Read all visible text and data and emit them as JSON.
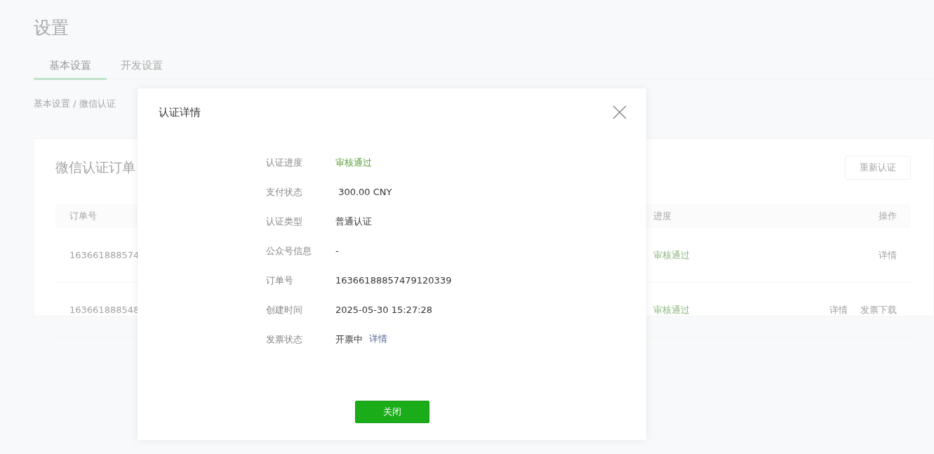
{
  "page": {
    "title": "设置",
    "tabs": [
      {
        "label": "基本设置",
        "selected": true
      },
      {
        "label": "开发设置",
        "selected": false
      }
    ],
    "breadcrumb": "基本设置 / 微信认证",
    "card": {
      "title": "微信认证订单",
      "action": "重新认证",
      "columns": [
        {
          "label": "订单号"
        },
        {
          "label": "进度"
        },
        {
          "label": "操作"
        }
      ],
      "rows": [
        {
          "order": "163661888574",
          "progress": "审核通过",
          "actions": [
            "详情"
          ]
        },
        {
          "order": "163661888548",
          "progress": "审核通过",
          "actions": [
            "详情",
            "发票下载"
          ]
        }
      ]
    }
  },
  "dialog": {
    "title": "认证详情",
    "fields": [
      {
        "label": "认证进度",
        "kind": "status",
        "value": "审核通过"
      },
      {
        "label": "支付状态",
        "kind": "text",
        "value": " 300.00 CNY"
      },
      {
        "label": "认证类型",
        "kind": "text",
        "value": "普通认证"
      },
      {
        "label": "公众号信息",
        "kind": "text",
        "value": "-"
      },
      {
        "label": "订单号",
        "kind": "text",
        "value": "16366188857479120339"
      },
      {
        "label": "创建时间",
        "kind": "text",
        "value": "2025-05-30 15:27:28"
      },
      {
        "label": "发票状态",
        "kind": "invoice",
        "value": "开票中",
        "link": "详情"
      }
    ],
    "button": "关闭"
  }
}
